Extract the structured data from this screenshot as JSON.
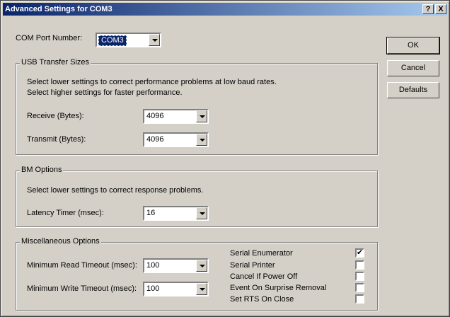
{
  "window": {
    "title": "Advanced Settings for COM3",
    "help_button": "?",
    "close_button": "X"
  },
  "com_port": {
    "label": "COM Port Number:",
    "value": "COM3"
  },
  "usb": {
    "title": "USB Transfer Sizes",
    "line1": "Select lower settings to correct performance problems at low baud rates.",
    "line2": "Select higher settings for faster performance.",
    "receive_label": "Receive (Bytes):",
    "receive_value": "4096",
    "transmit_label": "Transmit (Bytes):",
    "transmit_value": "4096"
  },
  "bm": {
    "title": "BM Options",
    "description": "Select lower settings to correct response problems.",
    "latency_label": "Latency Timer (msec):",
    "latency_value": "16"
  },
  "misc": {
    "title": "Miscellaneous Options",
    "read_label": "Minimum Read Timeout (msec):",
    "read_value": "100",
    "write_label": "Minimum Write Timeout (msec):",
    "write_value": "100",
    "options": [
      {
        "label": "Serial Enumerator",
        "checked": true
      },
      {
        "label": "Serial Printer",
        "checked": false
      },
      {
        "label": "Cancel If Power Off",
        "checked": false
      },
      {
        "label": "Event On Surprise Removal",
        "checked": false
      },
      {
        "label": "Set RTS On Close",
        "checked": false
      }
    ]
  },
  "buttons": {
    "ok": "OK",
    "cancel": "Cancel",
    "defaults": "Defaults"
  },
  "check_mark": "✔"
}
